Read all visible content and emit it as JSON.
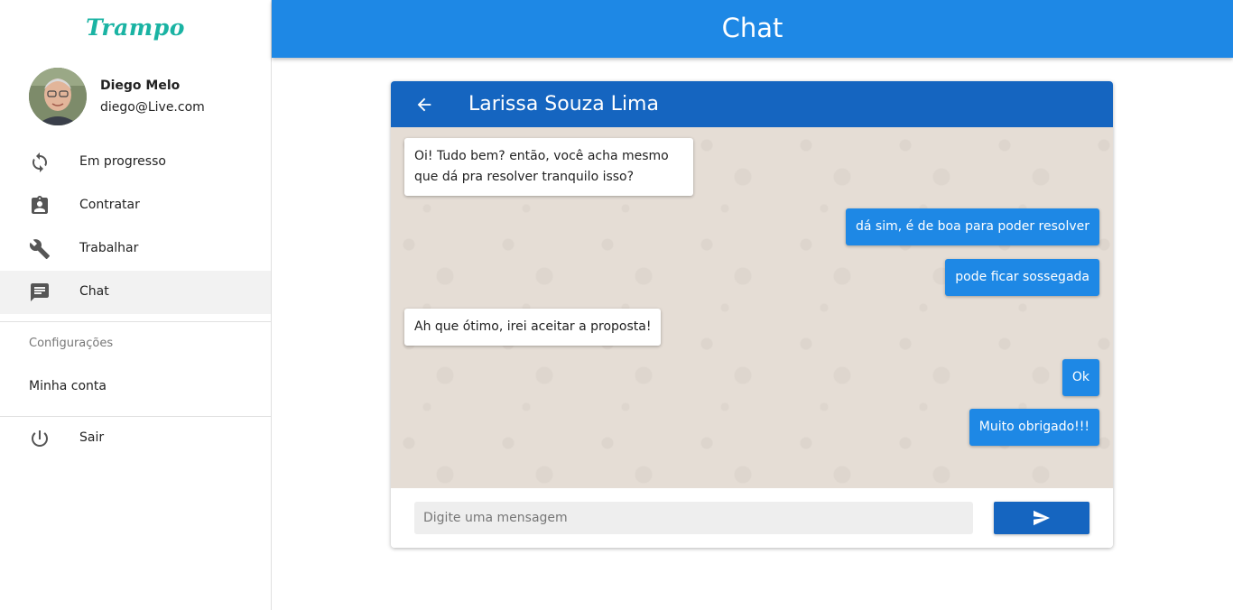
{
  "sidebar": {
    "logo": "Trampo",
    "user": {
      "name": "Diego Melo",
      "email": "diego@Live.com"
    },
    "items": [
      {
        "label": "Em progresso",
        "icon": "sync-icon"
      },
      {
        "label": "Contratar",
        "icon": "assignment-ind-icon"
      },
      {
        "label": "Trabalhar",
        "icon": "wrench-icon"
      },
      {
        "label": "Chat",
        "icon": "chat-icon",
        "active": true
      }
    ],
    "settings_title": "Configurações",
    "account_label": "Minha conta",
    "logout_label": "Sair"
  },
  "appbar": {
    "title": "Chat"
  },
  "chat": {
    "contact_name": "Larissa Souza Lima",
    "messages": [
      {
        "from": "contact",
        "text": "Oi! Tudo bem? então, você acha mesmo que dá pra resolver tranquilo isso?"
      },
      {
        "from": "me",
        "text": "dá sim, é de boa para poder resolver"
      },
      {
        "from": "me",
        "text": "pode ficar sossegada"
      },
      {
        "from": "contact",
        "text": "Ah que ótimo, irei aceitar a proposta!"
      },
      {
        "from": "me",
        "text": "Ok"
      },
      {
        "from": "me",
        "text": "Muito obrigado!!!"
      }
    ],
    "input_placeholder": "Digite uma mensagem",
    "input_value": ""
  },
  "colors": {
    "primary": "#1e88e5",
    "primary_dark": "#1565c0",
    "chat_background": "#e5ddd5",
    "logo": "#1ab3a3"
  }
}
